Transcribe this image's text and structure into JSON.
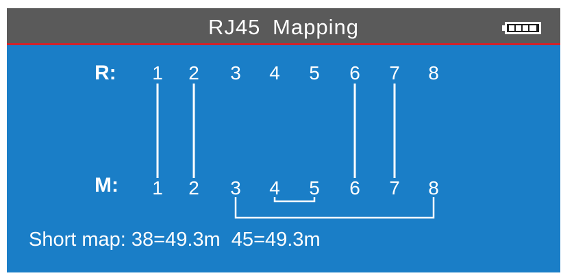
{
  "header": {
    "title": "RJ45  Mapping",
    "battery_icon": "battery-full-icon"
  },
  "remote": {
    "label": "R:",
    "pins": [
      "1",
      "2",
      "3",
      "4",
      "5",
      "6",
      "7",
      "8"
    ]
  },
  "main": {
    "label": "M:",
    "pins": [
      "1",
      "2",
      "3",
      "4",
      "5",
      "6",
      "7",
      "8"
    ]
  },
  "connections": [
    {
      "r": "1",
      "m": "1"
    },
    {
      "r": "2",
      "m": "2"
    },
    {
      "r": "6",
      "m": "6"
    },
    {
      "r": "7",
      "m": "7"
    }
  ],
  "shorts": [
    {
      "pins": [
        "3",
        "8"
      ]
    },
    {
      "pins": [
        "4",
        "5"
      ]
    }
  ],
  "short_map_text": "Short map: 38=49.3m  45=49.3m",
  "colors": {
    "screen_bg": "#1a7ec7",
    "title_bg": "#5a5a5a",
    "title_underline": "#d0232a",
    "foreground": "#ffffff"
  }
}
